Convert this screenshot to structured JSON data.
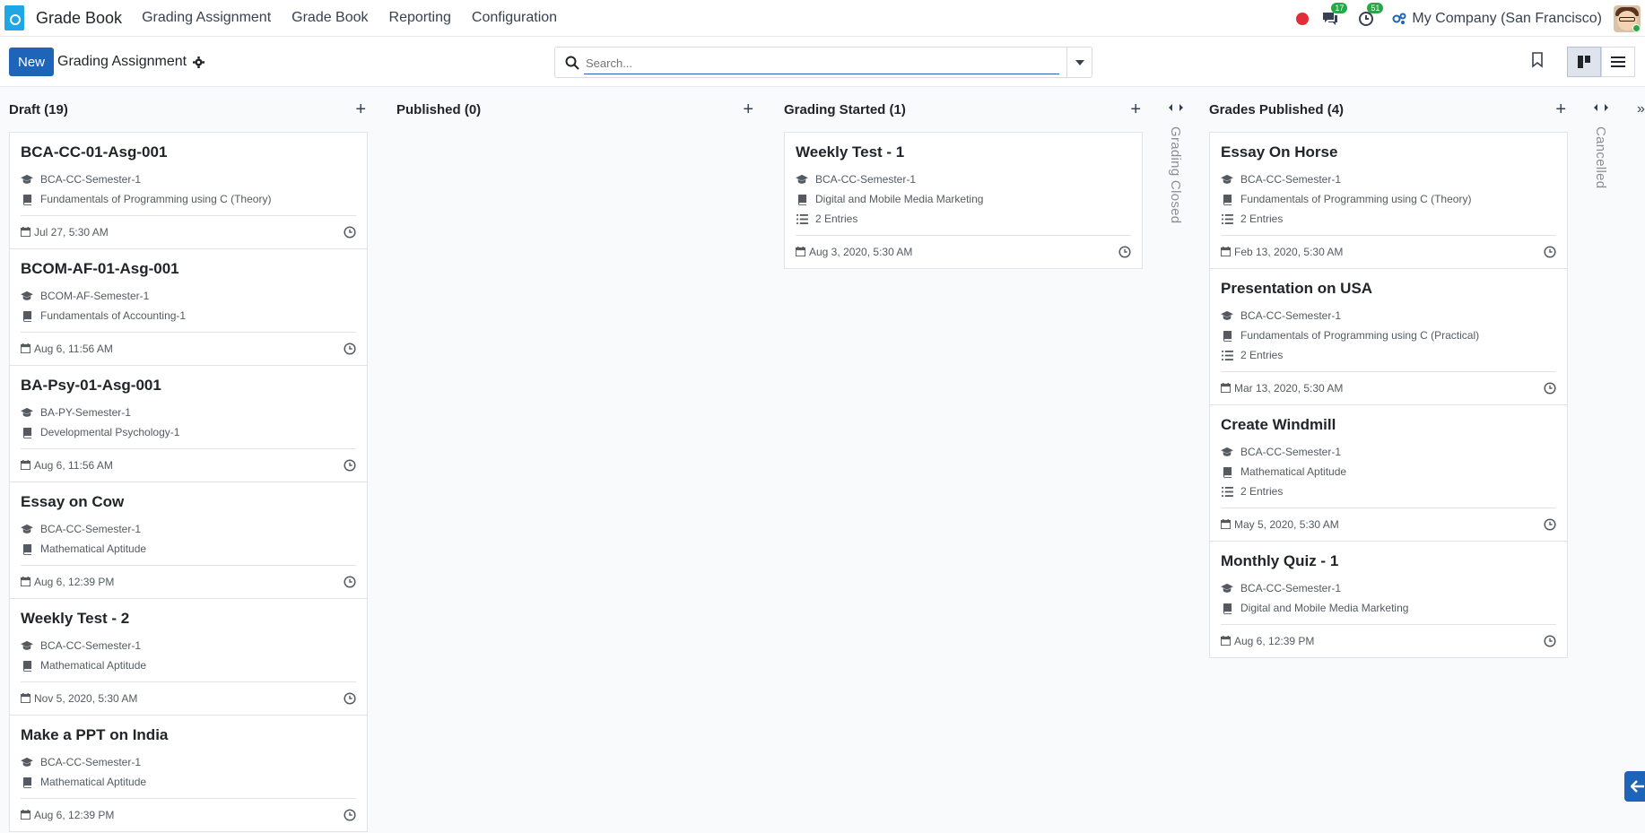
{
  "navbar": {
    "brand": "Grade Book",
    "menu": [
      "Grading Assignment",
      "Grade Book",
      "Reporting",
      "Configuration"
    ],
    "messages_count": "17",
    "activities_count": "51",
    "company": "My Company (San Francisco)"
  },
  "control": {
    "new_label": "New",
    "breadcrumb": "Grading Assignment",
    "search_placeholder": "Search..."
  },
  "columns": [
    {
      "title": "Draft (19)",
      "cards": [
        {
          "title": "BCA-CC-01-Asg-001",
          "semester": "BCA-CC-Semester-1",
          "subject": "Fundamentals of Programming using C (Theory)",
          "entries": null,
          "date": "Jul 27, 5:30 AM"
        },
        {
          "title": "BCOM-AF-01-Asg-001",
          "semester": "BCOM-AF-Semester-1",
          "subject": "Fundamentals of Accounting-1",
          "entries": null,
          "date": "Aug 6, 11:56 AM"
        },
        {
          "title": "BA-Psy-01-Asg-001",
          "semester": "BA-PY-Semester-1",
          "subject": "Developmental Psychology-1",
          "entries": null,
          "date": "Aug 6, 11:56 AM"
        },
        {
          "title": "Essay on Cow",
          "semester": "BCA-CC-Semester-1",
          "subject": "Mathematical Aptitude",
          "entries": null,
          "date": "Aug 6, 12:39 PM"
        },
        {
          "title": "Weekly Test - 2",
          "semester": "BCA-CC-Semester-1",
          "subject": "Mathematical Aptitude",
          "entries": null,
          "date": "Nov 5, 2020, 5:30 AM"
        },
        {
          "title": "Make a PPT on India",
          "semester": "BCA-CC-Semester-1",
          "subject": "Mathematical Aptitude",
          "entries": null,
          "date": "Aug 6, 12:39 PM"
        }
      ]
    },
    {
      "title": "Published (0)",
      "cards": []
    },
    {
      "title": "Grading Started (1)",
      "cards": [
        {
          "title": "Weekly Test - 1",
          "semester": "BCA-CC-Semester-1",
          "subject": "Digital and Mobile Media Marketing",
          "entries": "2 Entries",
          "date": "Aug 3, 2020, 5:30 AM"
        }
      ]
    },
    {
      "title": "Grades Published (4)",
      "cards": [
        {
          "title": "Essay On Horse",
          "semester": "BCA-CC-Semester-1",
          "subject": "Fundamentals of Programming using C (Theory)",
          "entries": "2 Entries",
          "date": "Feb 13, 2020, 5:30 AM"
        },
        {
          "title": "Presentation on USA",
          "semester": "BCA-CC-Semester-1",
          "subject": "Fundamentals of Programming using C (Practical)",
          "entries": "2 Entries",
          "date": "Mar 13, 2020, 5:30 AM"
        },
        {
          "title": "Create Windmill",
          "semester": "BCA-CC-Semester-1",
          "subject": "Mathematical Aptitude",
          "entries": "2 Entries",
          "date": "May 5, 2020, 5:30 AM"
        },
        {
          "title": "Monthly Quiz - 1",
          "semester": "BCA-CC-Semester-1",
          "subject": "Digital and Mobile Media Marketing",
          "entries": null,
          "date": "Aug 6, 12:39 PM"
        }
      ]
    }
  ],
  "folded": [
    "Grading Closed",
    "Cancelled"
  ]
}
